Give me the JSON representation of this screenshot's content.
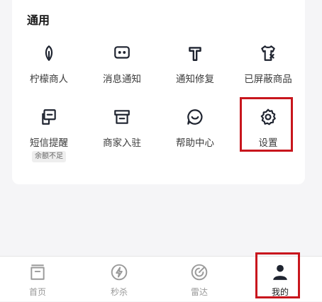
{
  "section": {
    "title": "通用"
  },
  "tiles": [
    {
      "label": "柠檬商人",
      "icon": "leaf-icon"
    },
    {
      "label": "消息通知",
      "icon": "chat-bubble-icon"
    },
    {
      "label": "通知修复",
      "icon": "hammer-icon"
    },
    {
      "label": "已屏蔽商品",
      "icon": "shirt-block-icon"
    },
    {
      "label": "短信提醒",
      "icon": "sms-icon",
      "sub": "余额不足"
    },
    {
      "label": "商家入驻",
      "icon": "store-icon"
    },
    {
      "label": "帮助中心",
      "icon": "help-chat-icon"
    },
    {
      "label": "设置",
      "icon": "gear-icon"
    }
  ],
  "tabbar": {
    "tabs": [
      {
        "label": "首页",
        "icon": "home-box-icon",
        "active": false
      },
      {
        "label": "秒杀",
        "icon": "lightning-icon",
        "active": false
      },
      {
        "label": "雷达",
        "icon": "radar-icon",
        "active": false
      },
      {
        "label": "我的",
        "icon": "user-icon",
        "active": true
      }
    ]
  },
  "colors": {
    "highlight": "#c8161d",
    "icon": "#1f2430",
    "tab_inactive": "#9a9a9a"
  }
}
